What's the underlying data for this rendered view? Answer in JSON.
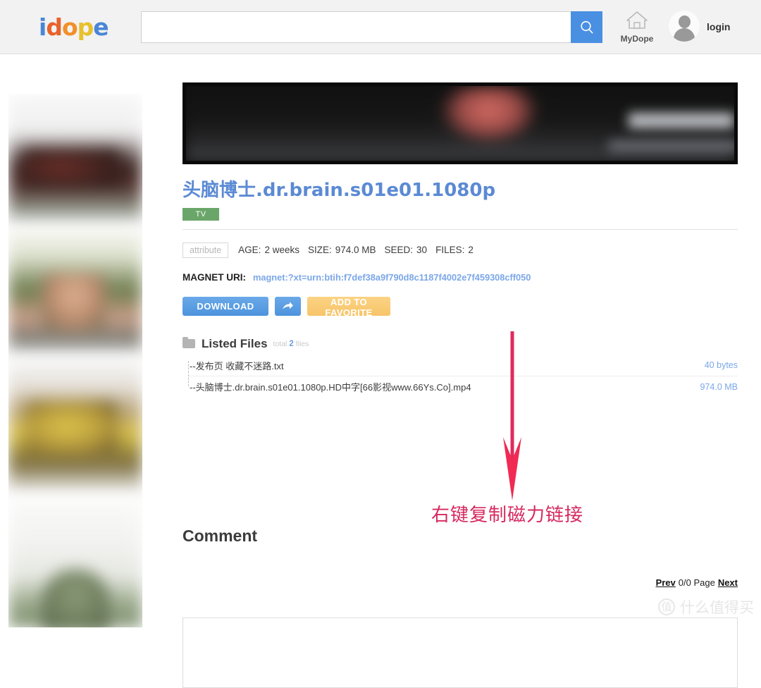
{
  "header": {
    "logo": {
      "letters": [
        "i",
        "d",
        "o",
        "p",
        "e"
      ],
      "full": "idope"
    },
    "search": {
      "value": "",
      "placeholder": ""
    },
    "mydope_label": "MyDope",
    "login_label": "login"
  },
  "torrent": {
    "title": "头脑博士.dr.brain.s01e01.1080p",
    "category_badge": "TV",
    "attribute_label": "attribute",
    "attributes": [
      {
        "key": "AGE:",
        "value": "2 weeks"
      },
      {
        "key": "SIZE:",
        "value": "974.0 MB"
      },
      {
        "key": "SEED:",
        "value": "30"
      },
      {
        "key": "FILES:",
        "value": "2"
      }
    ],
    "magnet_label": "MAGNET URI:",
    "magnet_uri": "magnet:?xt=urn:btih:f7def38a9f790d8c1187f4002e7f459308cff050",
    "buttons": {
      "download": "DOWNLOAD",
      "share": "share-arrow",
      "favorite": "ADD TO FAVORITE"
    }
  },
  "files": {
    "heading": "Listed Files",
    "meta_prefix": "total",
    "count": "2",
    "meta_suffix": "files",
    "items": [
      {
        "name": "--发布页 收藏不迷路.txt",
        "size": "40 bytes"
      },
      {
        "name": "--头脑博士.dr.brain.s01e01.1080p.HD中字[66影视www.66Ys.Co].mp4",
        "size": "974.0 MB"
      }
    ]
  },
  "annotation": {
    "text": "右键复制磁力链接",
    "color": "#d6285f"
  },
  "comment": {
    "heading": "Comment",
    "pager": {
      "prev": "Prev",
      "page": "0/0 Page",
      "next": "Next"
    },
    "textarea_value": "",
    "textarea_placeholder": ""
  },
  "watermark": {
    "mark": "值",
    "text": "什么值得买"
  },
  "colors": {
    "accent_blue": "#4a90e2",
    "link_blue": "#7ba7e8",
    "title_blue": "#5b8ad4",
    "badge_green": "#6aa66a",
    "fav_orange": "#f7c469",
    "annotation_pink": "#d6285f"
  }
}
